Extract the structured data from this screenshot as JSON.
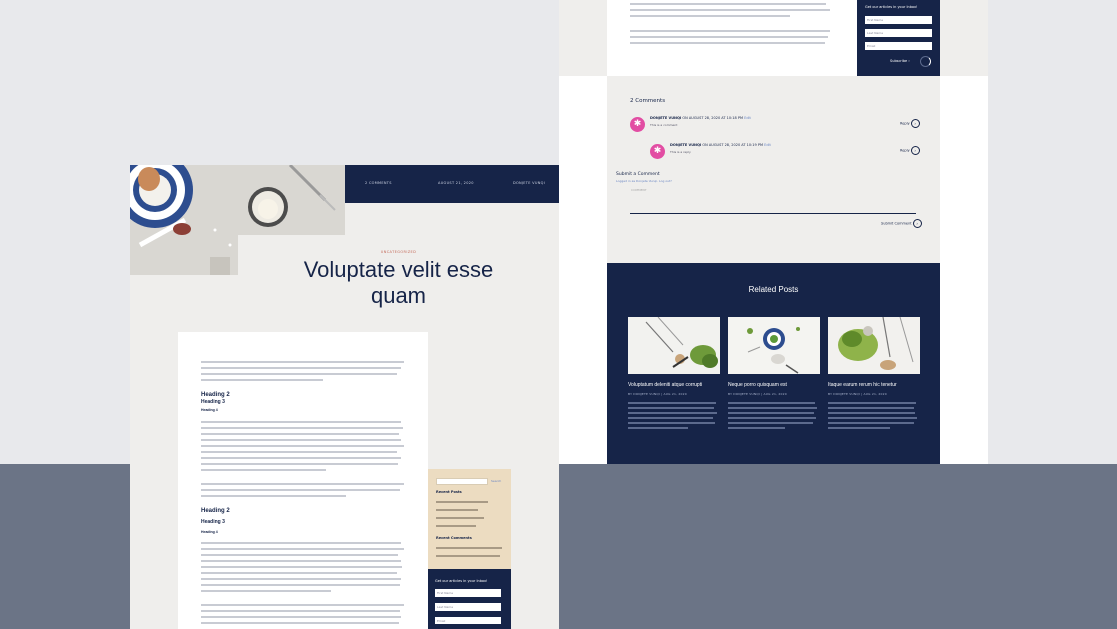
{
  "left_page": {
    "meta": {
      "comments": "2 COMMENTS",
      "date": "AUGUST 21, 2020",
      "author": "DONJETE VUNQI"
    },
    "category": "UNCATEGORIZED",
    "title_line1": "Voluptate velit esse",
    "title_line2": "quam",
    "headings": {
      "h2_a": "Heading 2",
      "h3_a": "Heading 3",
      "h4_a": "Heading 4",
      "h2_b": "Heading 2",
      "h3_b": "Heading 3",
      "h4_b": "Heading 4"
    },
    "sidebar": {
      "search_button": "Search",
      "recent_posts": "Recent Posts",
      "recent_comments": "Recent Comments"
    },
    "newsletter": {
      "heading": "Get our articles in your Inbox!",
      "first_name": "First Name",
      "last_name": "Last Name",
      "email": "Email"
    }
  },
  "right_page": {
    "newsletter": {
      "heading": "Get our articles in your Inbox!",
      "first_name": "First Name",
      "last_name": "Last Name",
      "email": "Email",
      "subscribe": "Subscribe"
    },
    "comments": {
      "title": "2 Comments",
      "items": [
        {
          "author": "DONJETE VUNQI",
          "date": "ON AUGUST 28, 2020 AT 10:18 PM",
          "edit": "Edit",
          "text": "This is a comment",
          "reply": "Reply"
        },
        {
          "author": "DONJETE VUNQI",
          "date": "ON AUGUST 28, 2020 AT 10:19 PM",
          "edit": "Edit",
          "text": "This is a reply",
          "reply": "Reply"
        }
      ],
      "respond_title": "Submit a Comment",
      "respond_sub": "Logged in as Donjete Vunqi. Log out?",
      "comment_label": "COMMENT",
      "submit": "Submit Comment"
    },
    "related": {
      "title": "Related Posts",
      "posts": [
        {
          "title": "Voluptatum deleniti atque corrupti",
          "meta": "BY DONJETE VUNQI | AUG 21, 2020"
        },
        {
          "title": "Neque porro quisquam est",
          "meta": "BY DONJETE VUNQI | AUG 21, 2020"
        },
        {
          "title": "Itaque earum rerum hic tenetur",
          "meta": "BY DONJETE VUNQI | AUG 21, 2020"
        }
      ]
    }
  },
  "colors": {
    "navy": "#162448",
    "accent_pink": "#e24da3",
    "sidebar_sand": "#ecdcc1",
    "canvas_gray": "#e8e9ec",
    "bottom_slate": "#6b7486"
  }
}
